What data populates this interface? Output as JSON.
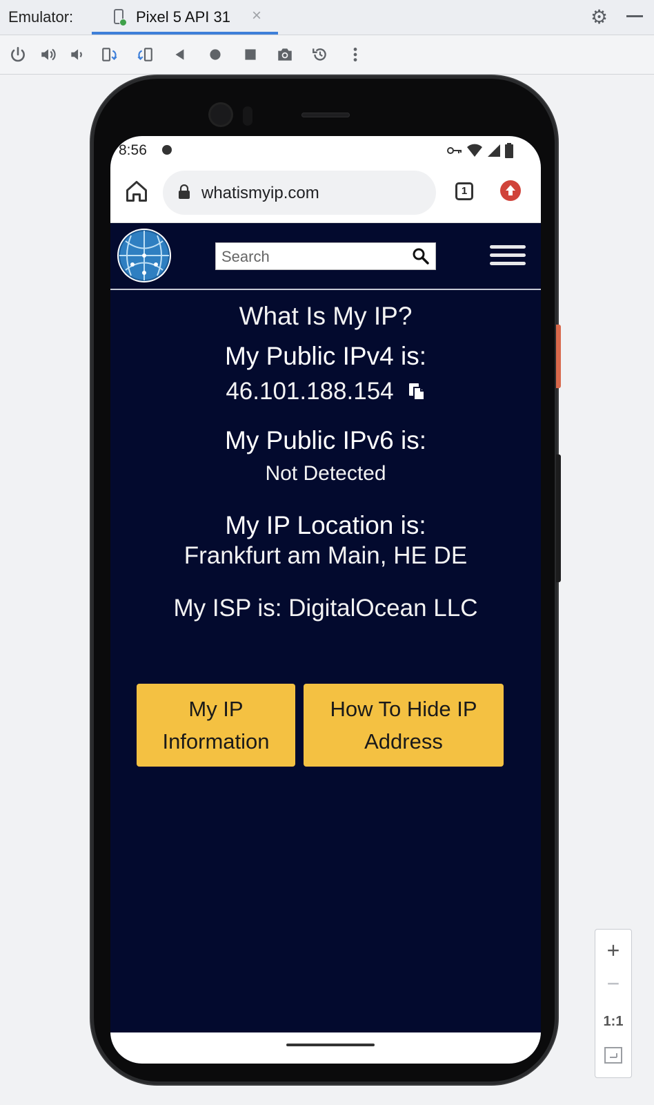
{
  "ide": {
    "panel_label": "Emulator:",
    "tab_name": "Pixel 5 API 31",
    "tab_close": "×"
  },
  "toolbar": {
    "icons": [
      "power-icon",
      "volume-up-icon",
      "volume-down-icon",
      "rotate-left-icon",
      "rotate-right-icon",
      "back-icon",
      "home-icon",
      "overview-icon",
      "screenshot-icon",
      "snapshot-icon",
      "more-icon"
    ]
  },
  "status": {
    "time": "8:56"
  },
  "browser": {
    "url": "whatismyip.com",
    "tab_count": "1"
  },
  "site": {
    "search_placeholder": "Search",
    "heading": "What Is My IP?",
    "ipv4_label": "My Public IPv4 is:",
    "ipv4_value": "46.101.188.154",
    "ipv6_label": "My Public IPv6 is:",
    "ipv6_value": "Not Detected",
    "location_label": "My IP Location is:",
    "location_value": "Frankfurt am Main, HE DE",
    "isp_label": "My ISP is:",
    "isp_value": "DigitalOcean LLC",
    "button1": "My IP Information",
    "button2": "How To Hide IP Address"
  },
  "zoom": {
    "in": "+",
    "out": "−",
    "actual": "1:1"
  },
  "colors": {
    "page_bg": "#030a2e",
    "button_bg": "#f4c142",
    "tab_underline": "#3d7fd9",
    "update_badge": "#d0433a"
  }
}
